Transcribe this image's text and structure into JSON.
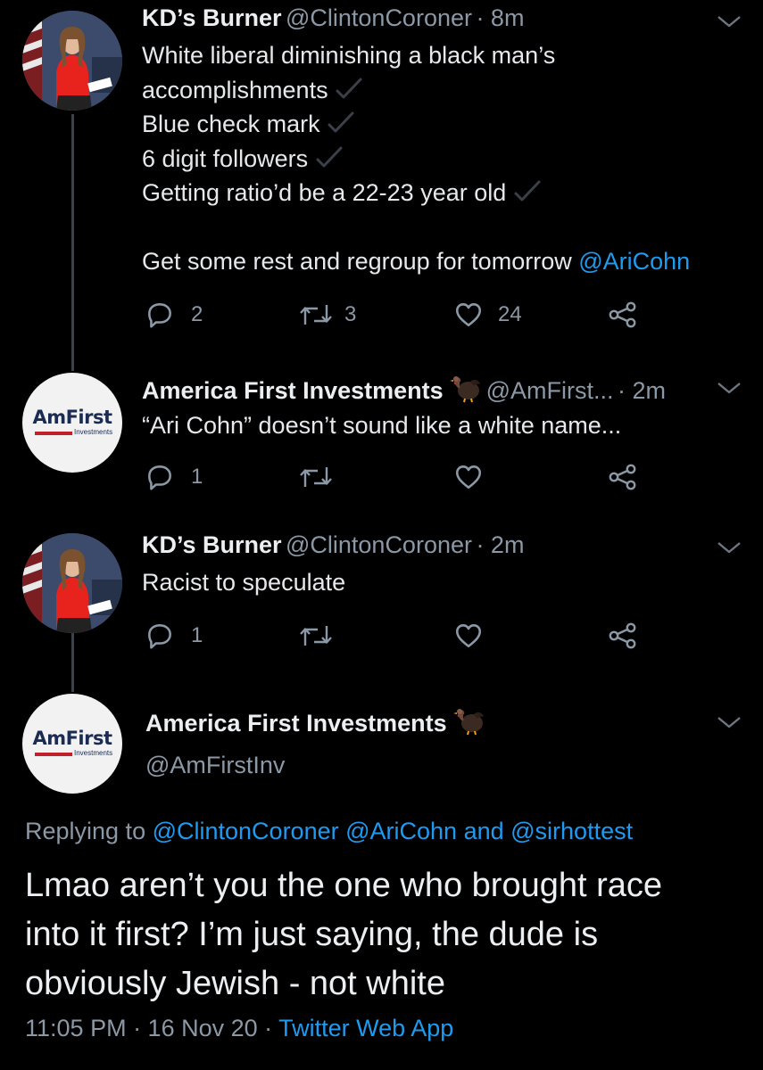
{
  "tweets": [
    {
      "author_name": "KD’s Burner",
      "author_handle": "@ClintonCoroner",
      "time": "· 8m",
      "lines": [
        "White liberal diminishing a black man’s",
        "accomplishments",
        "Blue check mark",
        "6 digit followers",
        "Getting ratio’d be a 22-23 year old"
      ],
      "closing_text": "Get some rest and regroup for tomorrow ",
      "closing_mention": "@AriCohn",
      "reply_count": "2",
      "retweet_count": "3",
      "like_count": "24"
    },
    {
      "author_name": "America First Investments",
      "author_handle": "@AmFirst...",
      "time": "· 2m",
      "text": "“Ari Cohn” doesn’t sound like a white name...",
      "reply_count": "1"
    },
    {
      "author_name": "KD’s Burner",
      "author_handle": "@ClintonCoroner",
      "time": "· 2m",
      "text": "Racist to speculate",
      "reply_count": "1"
    }
  ],
  "logo": {
    "main": "AmFirst",
    "sub": "Investments"
  },
  "focused": {
    "author_name": "America First Investments",
    "author_handle": "@AmFirstInv",
    "replying_prefix": "Replying to ",
    "replying_mention_1": "@ClintonCoroner",
    "replying_mention_2": "@AriCohn",
    "replying_and": " and ",
    "replying_mention_3": "@sirhottest",
    "text_lines": [
      "Lmao aren’t you the one who brought race",
      "into it first? I’m just saying, the dude is",
      "obviously Jewish - not white"
    ],
    "timestamp": "11:05 PM · 16 Nov 20 · ",
    "source": "Twitter Web App"
  },
  "icons": {
    "reply": "reply-icon",
    "retweet": "retweet-icon",
    "like": "heart-icon",
    "share": "share-icon",
    "more": "chevron-down-icon",
    "check": "checkmark-icon",
    "turkey": "turkey-emoji-icon"
  },
  "colors": {
    "background": "#000000",
    "link": "#1d9bf0",
    "muted": "#8b98a5",
    "text": "#e6e8eb"
  }
}
